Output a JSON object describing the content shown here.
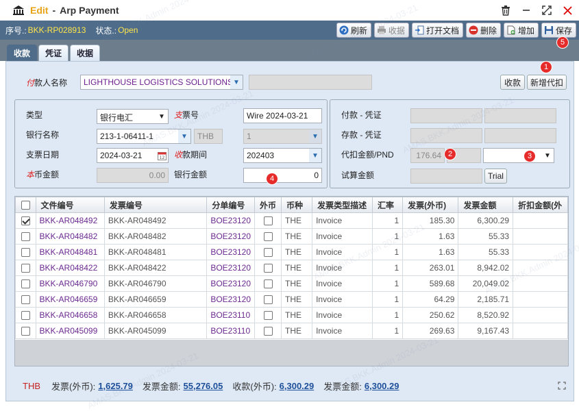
{
  "window": {
    "mode": "Edit",
    "separator": "-",
    "title": "Arp Payment"
  },
  "toolbar": {
    "seq_label": "序号.:",
    "seq_value": "BKK-RP028913",
    "status_label": "状态.:",
    "status_value": "Open",
    "refresh": "刷新",
    "collect": "收据",
    "open_doc": "打开文档",
    "delete": "删除",
    "add": "增加",
    "save": "保存"
  },
  "tabs": [
    "收款",
    "凭证",
    "收据"
  ],
  "payer": {
    "label_em": "付",
    "label": "款人名称",
    "value": "LIGHTHOUSE LOGISTICS SOLUTIONS",
    "collect_btn": "收款",
    "new_agent_btn": "新增代扣"
  },
  "left_form": {
    "type_label": "类型",
    "type_value": "银行电汇",
    "cheque_em": "支",
    "cheque_label": "票号",
    "cheque_value": "Wire 2024-03-21",
    "bank_label": "银行名称",
    "bank_value": "213-1-06411-1",
    "currency": "THB",
    "rate_value": "1",
    "cheque_date_label": "支票日期",
    "cheque_date_value": "2024-03-21",
    "period_em": "收",
    "period_label": "款期间",
    "period_value": "202403",
    "local_em": "本",
    "local_label": "币金额",
    "local_value": "0.00",
    "bank_amt_label": "银行金额",
    "bank_amt_value": "0"
  },
  "right_form": {
    "pay_voucher_label": "付款 - 凭证",
    "deposit_voucher_label": "存款 - 凭证",
    "withhold_label": "代扣金额/PND",
    "withhold_value": "176.64",
    "trial_label": "试算金额",
    "trial_btn": "Trial"
  },
  "grid": {
    "headers": [
      "文件编号",
      "发票编号",
      "分单编号",
      "外币",
      "币种",
      "发票类型描述",
      "汇率",
      "发票(外币)",
      "发票金额",
      "折扣金额(外"
    ],
    "rows": [
      {
        "checked": true,
        "doc": "BKK-AR048492",
        "inv": "BKK-AR048492",
        "sub": "BOE23120",
        "cur": "THE",
        "type": "Invoice",
        "rate": "1",
        "fx": "185.30",
        "amt": "6,300.29"
      },
      {
        "checked": false,
        "doc": "BKK-AR048482",
        "inv": "BKK-AR048482",
        "sub": "BOE23120",
        "cur": "THE",
        "type": "Invoice",
        "rate": "1",
        "fx": "1.63",
        "amt": "55.33"
      },
      {
        "checked": false,
        "doc": "BKK-AR048481",
        "inv": "BKK-AR048481",
        "sub": "BOE23120",
        "cur": "THE",
        "type": "Invoice",
        "rate": "1",
        "fx": "1.63",
        "amt": "55.33"
      },
      {
        "checked": false,
        "doc": "BKK-AR048422",
        "inv": "BKK-AR048422",
        "sub": "BOE23120",
        "cur": "THE",
        "type": "Invoice",
        "rate": "1",
        "fx": "263.01",
        "amt": "8,942.02"
      },
      {
        "checked": false,
        "doc": "BKK-AR046790",
        "inv": "BKK-AR046790",
        "sub": "BOE23120",
        "cur": "THE",
        "type": "Invoice",
        "rate": "1",
        "fx": "589.68",
        "amt": "20,049.02"
      },
      {
        "checked": false,
        "doc": "BKK-AR046659",
        "inv": "BKK-AR046659",
        "sub": "BOE23120",
        "cur": "THE",
        "type": "Invoice",
        "rate": "1",
        "fx": "64.29",
        "amt": "2,185.71"
      },
      {
        "checked": false,
        "doc": "BKK-AR046658",
        "inv": "BKK-AR046658",
        "sub": "BOE23110",
        "cur": "THE",
        "type": "Invoice",
        "rate": "1",
        "fx": "250.62",
        "amt": "8,520.92"
      },
      {
        "checked": false,
        "doc": "BKK-AR045099",
        "inv": "BKK-AR045099",
        "sub": "BOE23110",
        "cur": "THE",
        "type": "Invoice",
        "rate": "1",
        "fx": "269.63",
        "amt": "9,167.43"
      }
    ]
  },
  "footer": {
    "currency": "THB",
    "inv_fx_label": "发票(外币):",
    "inv_fx_value": "1,625.79",
    "inv_amt_label": "发票金额:",
    "inv_amt_value": "55,276.05",
    "recv_fx_label": "收款(外币):",
    "recv_fx_value": "6,300.29",
    "recv_amt_label": "发票金额:",
    "recv_amt_value": "6,300.29"
  },
  "badges": [
    "1",
    "2",
    "3",
    "4",
    "5"
  ],
  "watermark": "AMAS.BKK.Admin 2024-03-21",
  "colors": {
    "accent": "#e8a317",
    "toolbar_bg": "#4f6d8a",
    "status_yellow": "#ffe54a",
    "badge_red": "#e62b2b",
    "link_purple": "#6b2a90",
    "total_blue": "#1d4f9a"
  }
}
